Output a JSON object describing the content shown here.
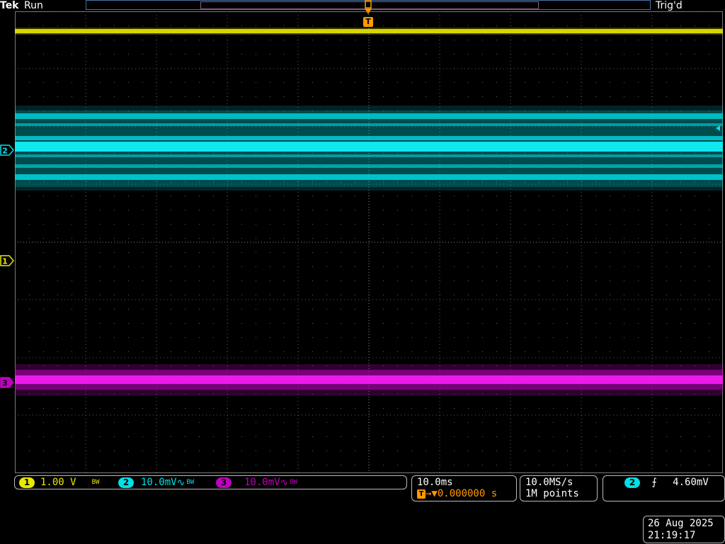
{
  "header": {
    "brand": "Tek",
    "run_state": "Run",
    "trigger_status": "Trig'd",
    "trigger_position_marker": "T"
  },
  "channel_markers": {
    "ch1": "1",
    "ch2": "2",
    "ch3": "3"
  },
  "channels": [
    {
      "id": "1",
      "scale": "1.00 V",
      "bandwidth_limit": "BW",
      "color": "#e8e800"
    },
    {
      "id": "2",
      "scale": "10.0mV",
      "coupling_icon": "∿",
      "bandwidth_limit": "BW",
      "color": "#00e0e8"
    },
    {
      "id": "3",
      "scale": "10.0mV",
      "coupling_icon": "∿",
      "bandwidth_limit": "BW",
      "color": "#c000c0"
    }
  ],
  "timebase": {
    "scale": "10.0ms",
    "trigger_icon": "T",
    "delay": "→▼0.000000 s"
  },
  "acquisition": {
    "sample_rate": "10.0MS/s",
    "record_length": "1M points"
  },
  "trigger": {
    "source": "2",
    "slope_icon": "rising-edge-icon",
    "slope_glyph": "⨍",
    "level": "4.60mV"
  },
  "datetime": {
    "date": "26 Aug 2025",
    "time": "21:19:17"
  },
  "colors": {
    "ch1": "#e8e800",
    "ch2": "#00e0e8",
    "ch3": "#c000c0",
    "trigger": "#ff9a00",
    "graticule": "#7a7a7a"
  }
}
